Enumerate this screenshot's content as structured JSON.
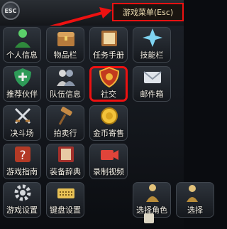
{
  "header": {
    "esc_label": "ESC",
    "title": "游戏菜单(Esc)"
  },
  "menu": [
    {
      "label": "个人信息",
      "icon": "person-icon"
    },
    {
      "label": "物品栏",
      "icon": "chest-icon"
    },
    {
      "label": "任务手册",
      "icon": "quest-book-icon"
    },
    {
      "label": "技能栏",
      "icon": "skill-star-icon"
    },
    {
      "label": "推荐伙伴",
      "icon": "shield-icon"
    },
    {
      "label": "队伍信息",
      "icon": "party-icon"
    },
    {
      "label": "社交",
      "icon": "social-shield-icon",
      "highlighted": true
    },
    {
      "label": "邮件箱",
      "icon": "mail-icon"
    },
    {
      "label": "决斗场",
      "icon": "crossed-swords-icon"
    },
    {
      "label": "拍卖行",
      "icon": "gavel-icon"
    },
    {
      "label": "金币寄售",
      "icon": "gold-coin-icon"
    },
    {
      "label": "游戏指南",
      "icon": "question-icon"
    },
    {
      "label": "装备辞典",
      "icon": "book-icon"
    },
    {
      "label": "录制视频",
      "icon": "video-icon"
    },
    {
      "label": "游戏设置",
      "icon": "gear-icon"
    },
    {
      "label": "键盘设置",
      "icon": "keyboard-icon"
    },
    {
      "label": "选择角色",
      "icon": "character-select-icon"
    },
    {
      "label": "选择",
      "icon": "server-select-icon"
    }
  ],
  "colors": {
    "highlight": "#ee1111",
    "text": "#f4f0e6"
  }
}
